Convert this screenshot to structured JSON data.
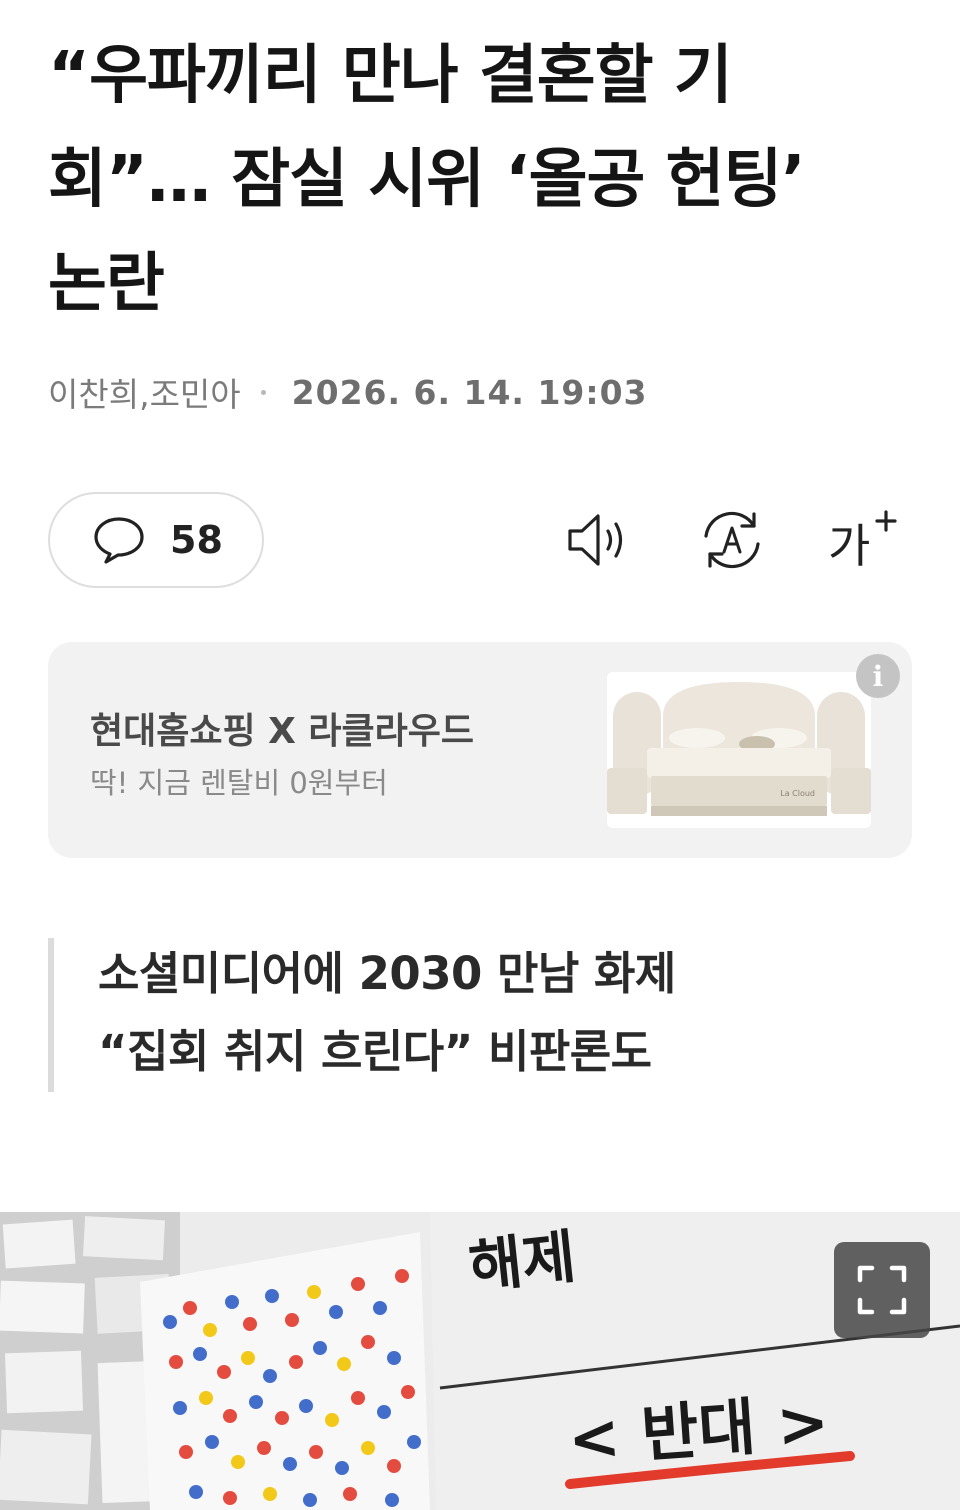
{
  "article": {
    "headline_lines": [
      "“우파끼리 만나 결혼할 기",
      "회”… 잠실 시위 ‘올공 헌팅’",
      "논란"
    ],
    "authors": "이찬희,조민아",
    "date": "2026. 6. 14. 19:03",
    "subheadline_lines": [
      "소셜미디어에 2030 만남 화제",
      "“집회 취지 흐린다” 비판론도"
    ]
  },
  "toolbar": {
    "comment_count": "58",
    "icons": [
      "comment-icon",
      "speaker-icon",
      "translate-icon",
      "font-size-icon"
    ],
    "font_size_label": "가"
  },
  "ad": {
    "title": "현대홈쇼핑 X 라클라우드",
    "subtitle": "딱! 지금 렌탈비 0원부터",
    "image_brand": "La Cloud",
    "info_label": "i"
  },
  "photo": {
    "sign_text_top": "해제",
    "sign_text_main": "< 반대 >",
    "expand_icon": "fullscreen-icon"
  },
  "colors": {
    "text_primary": "#151515",
    "text_muted": "#7b7b7b",
    "ad_background": "#f2f2f2",
    "border": "#dedede"
  }
}
